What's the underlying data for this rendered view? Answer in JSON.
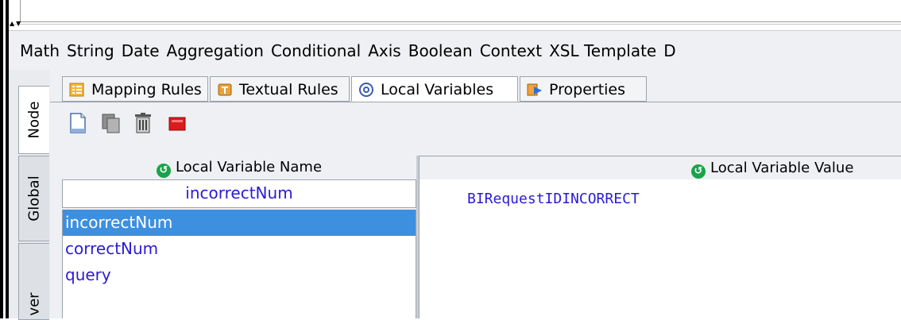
{
  "menu": [
    "Math",
    "String",
    "Date",
    "Aggregation",
    "Conditional",
    "Axis",
    "Boolean",
    "Context",
    "XSL Template",
    "D"
  ],
  "side_tabs": {
    "node": "Node",
    "global": "Global",
    "other": "ver"
  },
  "tabs": [
    {
      "label": "Mapping Rules",
      "icon": "mapping-rules-icon"
    },
    {
      "label": "Textual Rules",
      "icon": "textual-rules-icon"
    },
    {
      "label": "Local Variables",
      "icon": "at-sign-icon",
      "active": true
    },
    {
      "label": "Properties",
      "icon": "properties-icon"
    }
  ],
  "toolbar": [
    "new-document-icon",
    "copy-icon",
    "delete-icon",
    "stop-icon"
  ],
  "left_pane": {
    "header": "Local Variable Name",
    "field_value": "incorrectNum",
    "items": [
      "incorrectNum",
      "correctNum",
      "query"
    ],
    "selected": "incorrectNum"
  },
  "right_pane": {
    "header": "Local Variable Value",
    "value": "BIRequestIDINCORRECT"
  },
  "colors": {
    "selection": "#3d8fe0",
    "value_text": "#2a1bd6",
    "header_icon": "#1aa34a"
  }
}
